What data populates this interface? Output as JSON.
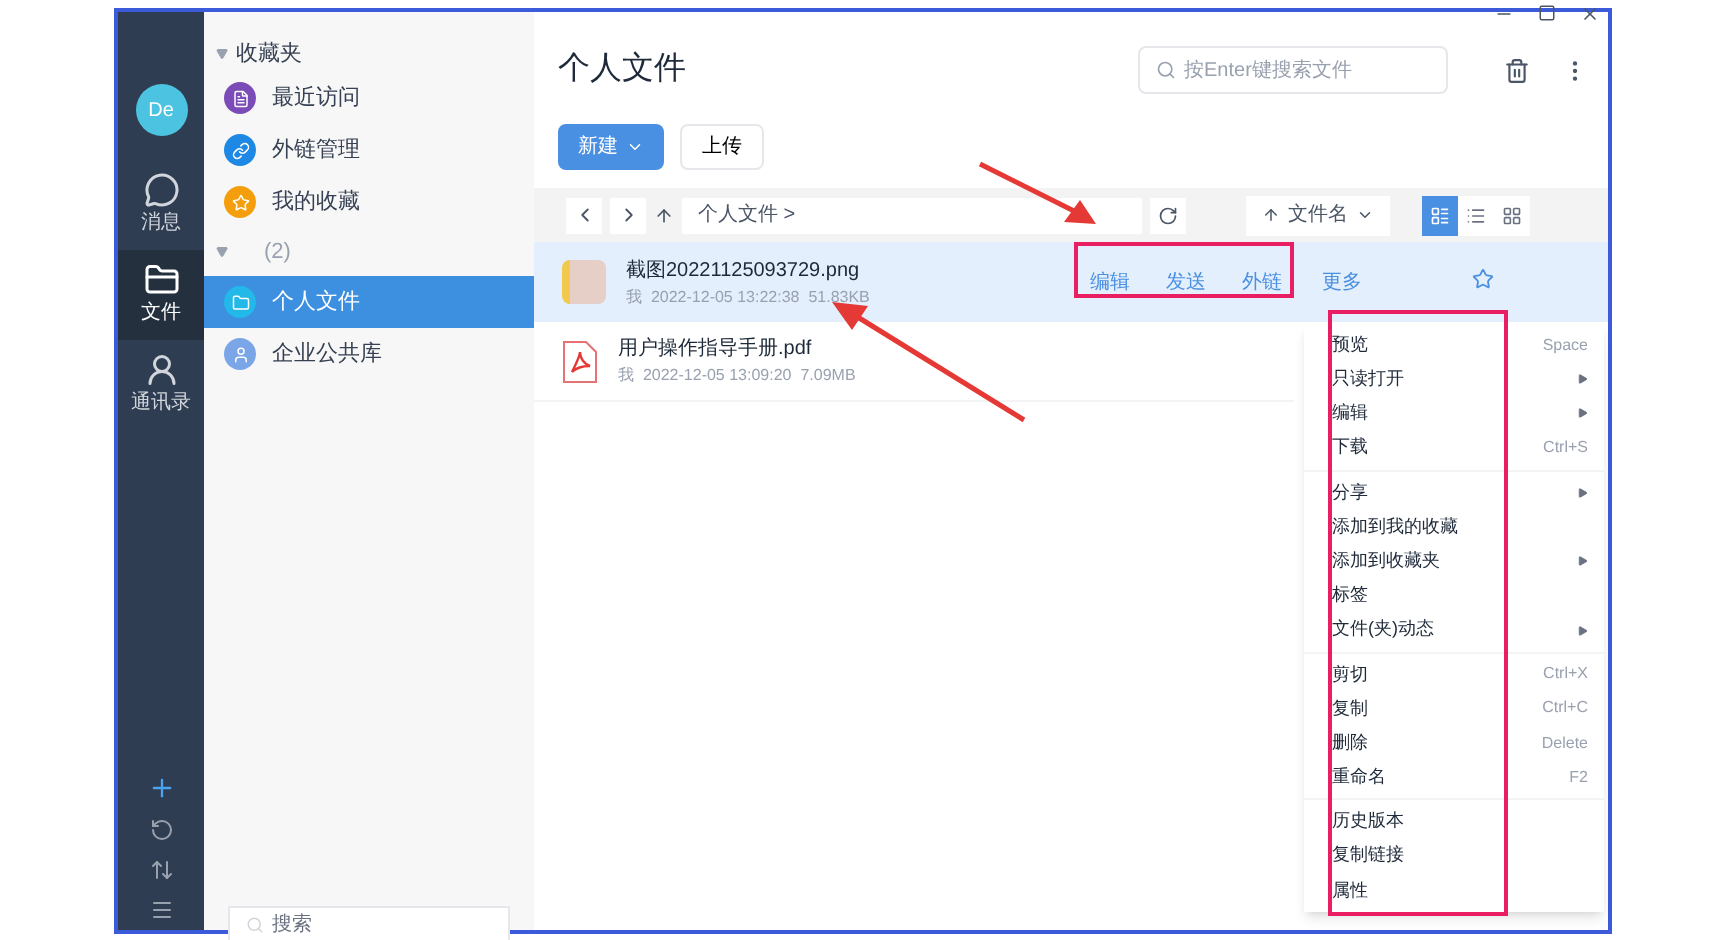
{
  "rail": {
    "avatar": "De",
    "items": [
      {
        "kind": "chat",
        "label": "消息",
        "selected": false
      },
      {
        "kind": "folder",
        "label": "文件",
        "selected": true
      },
      {
        "kind": "contacts",
        "label": "通讯录",
        "selected": false
      }
    ]
  },
  "sidebar": {
    "favorites": {
      "title": "收藏夹",
      "expanded": true,
      "items": [
        {
          "kind": "doc",
          "label": "最近访问",
          "color": "#7b4bb8"
        },
        {
          "kind": "link",
          "label": "外链管理",
          "color": "#1e88e5"
        },
        {
          "kind": "star",
          "label": "我的收藏",
          "color": "#f59e0b"
        }
      ]
    },
    "group": {
      "count": "(2)",
      "expanded": true,
      "items": [
        {
          "kind": "folder",
          "label": "个人文件",
          "selected": true,
          "color": "#22b8e8"
        },
        {
          "kind": "user",
          "label": "企业公共库",
          "selected": false,
          "color": "#7aa6e8"
        }
      ]
    },
    "search": {
      "placeholder": "搜索"
    }
  },
  "main": {
    "title": "个人文件",
    "search": {
      "placeholder": "按Enter键搜索文件"
    },
    "new_button": "新建",
    "upload_button": "上传",
    "breadcrumb": "个人文件 >",
    "sort": "文件名",
    "views": [
      {
        "kind": "detail",
        "selected": true
      },
      {
        "kind": "list",
        "selected": false
      },
      {
        "kind": "grid",
        "selected": false
      }
    ],
    "files": [
      {
        "kind": "image",
        "name": "截图20221125093729.png",
        "owner": "我",
        "date": "2022-12-05 13:22:38",
        "size": "51.83KB",
        "selected": true,
        "actions": [
          "编辑",
          "发送",
          "外链"
        ],
        "more": "更多"
      },
      {
        "kind": "pdf",
        "name": "用户操作指导手册.pdf",
        "owner": "我",
        "date": "2022-12-05 13:09:20",
        "size": "7.09MB",
        "selected": false
      }
    ]
  },
  "context_menu": [
    [
      {
        "label": "预览",
        "shortcut": "Space"
      },
      {
        "label": "只读打开",
        "submenu": true
      },
      {
        "label": "编辑",
        "submenu": true
      },
      {
        "label": "下载",
        "shortcut": "Ctrl+S"
      }
    ],
    [
      {
        "label": "分享",
        "submenu": true
      },
      {
        "label": "添加到我的收藏"
      },
      {
        "label": "添加到收藏夹",
        "submenu": true
      },
      {
        "label": "标签"
      },
      {
        "label": "文件(夹)动态",
        "submenu": true
      }
    ],
    [
      {
        "label": "剪切",
        "shortcut": "Ctrl+X"
      },
      {
        "label": "复制",
        "shortcut": "Ctrl+C"
      },
      {
        "label": "删除",
        "shortcut": "Delete"
      },
      {
        "label": "重命名",
        "shortcut": "F2"
      }
    ],
    [
      {
        "label": "历史版本"
      },
      {
        "label": "复制链接"
      },
      {
        "label": "属性"
      }
    ]
  ]
}
